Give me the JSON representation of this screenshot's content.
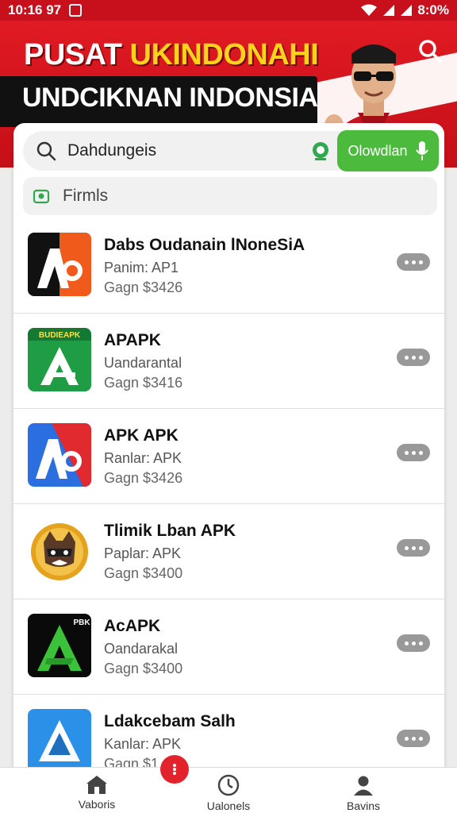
{
  "status_bar": {
    "time": "10:16 97",
    "battery": "8:0%"
  },
  "banner": {
    "title_part1": "PUSAT ",
    "title_highlight": "UKINDONAHI",
    "title_line2": "UNDCIKNAN INDONSIA"
  },
  "search": {
    "value": "Dahdungeis",
    "button_label": "Olowdlan"
  },
  "filter": {
    "label": "Firmls"
  },
  "apps": [
    {
      "name": "Dabs Oudanain lNoneSiA",
      "subtitle": "Panim: AP1",
      "meta": "Gagn  $3426",
      "icon": "ao-orange-app-icon"
    },
    {
      "name": "APAPK",
      "subtitle": "Uandarantal",
      "meta": "Gagn  $3416",
      "icon": "green-apk-app-icon"
    },
    {
      "name": "APK APK",
      "subtitle": "Ranlar: APK",
      "meta": "Gagn  $3426",
      "icon": "ao-blue-red-app-icon"
    },
    {
      "name": "Tlimik Lban APK",
      "subtitle": "Paplar: APK",
      "meta": "Gagn  $3400",
      "icon": "raccoon-app-icon"
    },
    {
      "name": "AcAPK",
      "subtitle": "Oandarakal",
      "meta": "Gagn  $3400",
      "icon": "green-a-app-icon"
    },
    {
      "name": "Ldakcebam Salh",
      "subtitle": "Kanlar: APK",
      "meta": "Gagn  $1",
      "icon": "blue-a-app-icon"
    }
  ],
  "bottom_nav": [
    {
      "label": "Vaboris",
      "icon": "home-icon"
    },
    {
      "label": "Ualonels",
      "icon": "clock-icon"
    },
    {
      "label": "Bavins",
      "icon": "profile-icon"
    }
  ],
  "colors": {
    "brand_red": "#c8101c",
    "accent_green": "#4cba3c",
    "highlight_yellow": "#ffd21c"
  }
}
